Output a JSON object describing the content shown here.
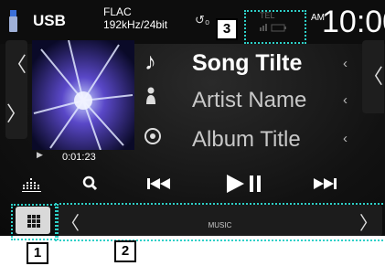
{
  "status_bar": {
    "source": "USB",
    "format_line1": "FLAC",
    "format_line2": "192kHz/24bit",
    "repeat_icon_text": "↺₀",
    "tel_label": "TEL",
    "am_pm": "AM",
    "clock": "10:00"
  },
  "track": {
    "song_title": "Song Tilte",
    "artist_name": "Artist Name",
    "album_title": "Album Title",
    "elapsed_time": "0:01:23"
  },
  "nav": {
    "left_up": "〈",
    "left_down": "〉",
    "right": "〈",
    "row_chevron": "‹"
  },
  "controls": {
    "equalizer_icon": "equalizer-icon",
    "search_icon": "search-icon",
    "prev_icon": "previous-track-icon",
    "play_pause_icon": "play-pause-icon",
    "next_icon": "next-track-icon"
  },
  "bottom": {
    "music_label": "MUSIC",
    "arrow_left": "〈",
    "arrow_right": "〉"
  },
  "callouts": [
    "1",
    "2",
    "3"
  ],
  "colors": {
    "callout": "#2ed0c8",
    "screen_bg": "#121212",
    "title_text": "#ffffff",
    "secondary_text": "#c8c8c8"
  }
}
